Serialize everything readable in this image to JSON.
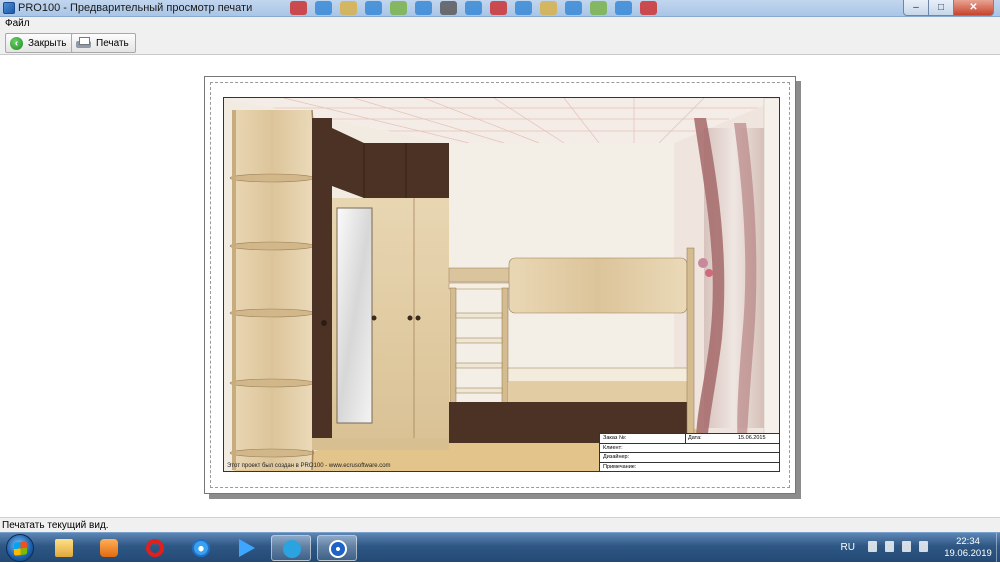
{
  "window": {
    "title": "PRO100 - Предварительный просмотр печати",
    "buttons": {
      "minimize": "–",
      "maximize": "□",
      "close": "✕"
    }
  },
  "menu": {
    "file": "Файл"
  },
  "toolbar": {
    "close_label": "Закрыть",
    "print_label": "Печать",
    "close_icon": "back-arrow-icon",
    "print_icon": "printer-icon"
  },
  "page": {
    "footer_note": "Этот проект был создан в PRO100 - www.ecrusoftware.com",
    "stamp": {
      "order_label": "Заказ №:",
      "date_label": "Дата:",
      "date_value": "15.06.2015",
      "client_label": "Клиент:",
      "designer_label": "Дизайнер:",
      "note_label": "Примечание:"
    }
  },
  "status": {
    "text": "Печатать текущий вид."
  },
  "taskbar": {
    "items": [
      "explorer-icon",
      "media-player-icon",
      "opera-icon",
      "ie-icon",
      "play-icon",
      "telegram-icon",
      "pro100-icon"
    ],
    "language": "RU",
    "time": "22:34",
    "date": "19.06.2019"
  },
  "colors": {
    "light_wood": "#e3cfa9",
    "dark_wood": "#4b3224",
    "wall": "#f3efe6",
    "floor": "#e3c58c",
    "curtain": "#a46a6a"
  }
}
